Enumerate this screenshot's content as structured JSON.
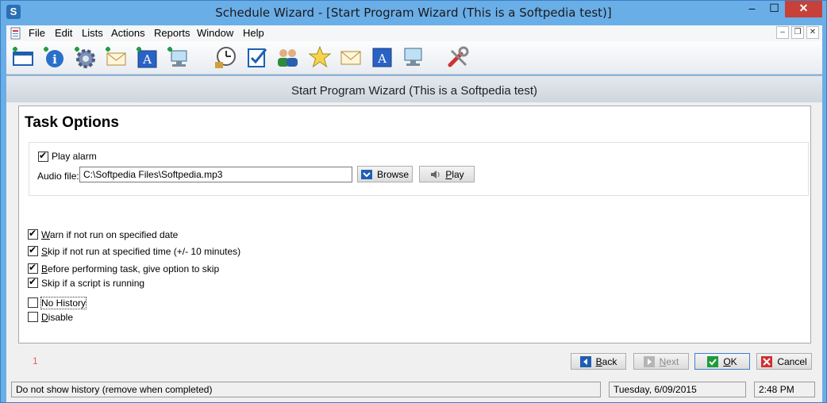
{
  "window": {
    "title": "Schedule Wizard - [Start Program Wizard  (This is a Softpedia test)]",
    "app_icon": "S",
    "minimize": "–",
    "maximize": "☐",
    "close": "✕"
  },
  "menubar": {
    "items": [
      "File",
      "Edit",
      "Lists",
      "Actions",
      "Reports",
      "Window",
      "Help"
    ],
    "mdi_minimize": "–",
    "mdi_restore": "❐",
    "mdi_close": "✕"
  },
  "toolbar": {
    "icons": [
      "new-event-icon",
      "add-info-icon",
      "add-gear-icon",
      "add-email-icon",
      "add-message-icon",
      "add-network-icon",
      "clock-icon",
      "task-check-icon",
      "users-icon",
      "star-icon",
      "email-icon",
      "message-icon",
      "network-icon",
      "tools-icon"
    ]
  },
  "wizard": {
    "title": "Start Program Wizard  (This is a Softpedia test)",
    "section_title": "Task Options",
    "play_alarm": {
      "label": "Play alarm",
      "checked": true
    },
    "audio_file": {
      "label": "Audio file:",
      "value": "C:\\Softpedia Files\\Softpedia.mp3"
    },
    "browse_label": "Browse",
    "play_label": "Play",
    "options": [
      {
        "label": "Warn if not run on specified date",
        "checked": true
      },
      {
        "label": "Skip if not run at specified time (+/- 10 minutes)",
        "checked": true
      },
      {
        "label": "Before performing task, give option to skip",
        "checked": true
      },
      {
        "label": "Skip if a script is running",
        "checked": true
      },
      {
        "label": "No History",
        "checked": false
      },
      {
        "label": "Disable",
        "checked": false
      }
    ],
    "page_number": "1",
    "back_label": "Back",
    "next_label": "Next",
    "ok_label": "OK",
    "cancel_label": "Cancel"
  },
  "statusbar": {
    "message": "Do not show history (remove when completed)",
    "date": "Tuesday,  6/09/2015",
    "time": "2:48 PM"
  },
  "colors": {
    "title_bar": "#6aaee8",
    "close_button": "#c7413a",
    "accent_blue": "#1f5fb0",
    "ok_green": "#1e9c3c",
    "cancel_red": "#d03030"
  }
}
